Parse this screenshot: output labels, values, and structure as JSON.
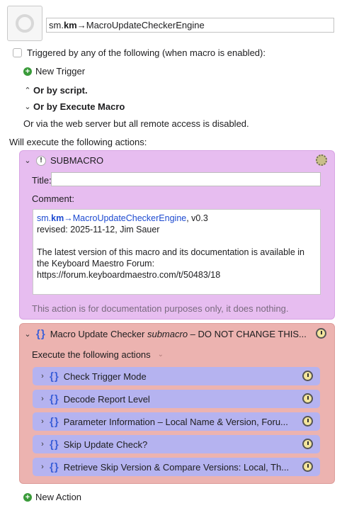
{
  "macro": {
    "name_prefix": "sm.",
    "name_bold": "km",
    "name_rest": "→MacroUpdateCheckerEngine"
  },
  "triggers": {
    "checkbox_label": "Triggered by any of the following (when macro is enabled):",
    "new_trigger": "New Trigger",
    "or_by_script": "Or by script.",
    "or_by_execute": "Or by Execute Macro",
    "web_server_note": "Or via the web server but all remote access is disabled."
  },
  "actions_header": "Will execute the following actions:",
  "submacro": {
    "title": "SUBMACRO",
    "title_label": "Title:",
    "comment_label": "Comment:",
    "comment": {
      "link_prefix": "sm.",
      "link_bold": "km",
      "link_rest": "→MacroUpdateCheckerEngine",
      "version": ", v0.3",
      "revised": "revised: 2025-11-12, Jim Sauer",
      "body": "The latest version of this macro and its documentation is available in the Keyboard Maestro Forum:",
      "url": "https://forum.keyboardmaestro.com/t/50483/18"
    },
    "note": "This action is for documentation purposes only, it does nothing."
  },
  "group": {
    "title_main": "Macro Update Checker ",
    "title_italic": "submacro",
    "title_rest": " – DO NOT CHANGE THIS...",
    "execute_label": "Execute the following actions",
    "actions": [
      {
        "label": "Check Trigger Mode"
      },
      {
        "label": "Decode Report Level"
      },
      {
        "label": "Parameter Information – Local Name & Version, Foru..."
      },
      {
        "label": "Skip Update Check?"
      },
      {
        "label": "Retrieve Skip Version & Compare Versions: Local, Th..."
      }
    ]
  },
  "new_action": "New Action",
  "colors": {
    "submacro_bg": "#e7bdf0",
    "group_bg": "#ecb3b0",
    "action_bg": "#b5b3f0",
    "link": "#1d4ad0"
  }
}
